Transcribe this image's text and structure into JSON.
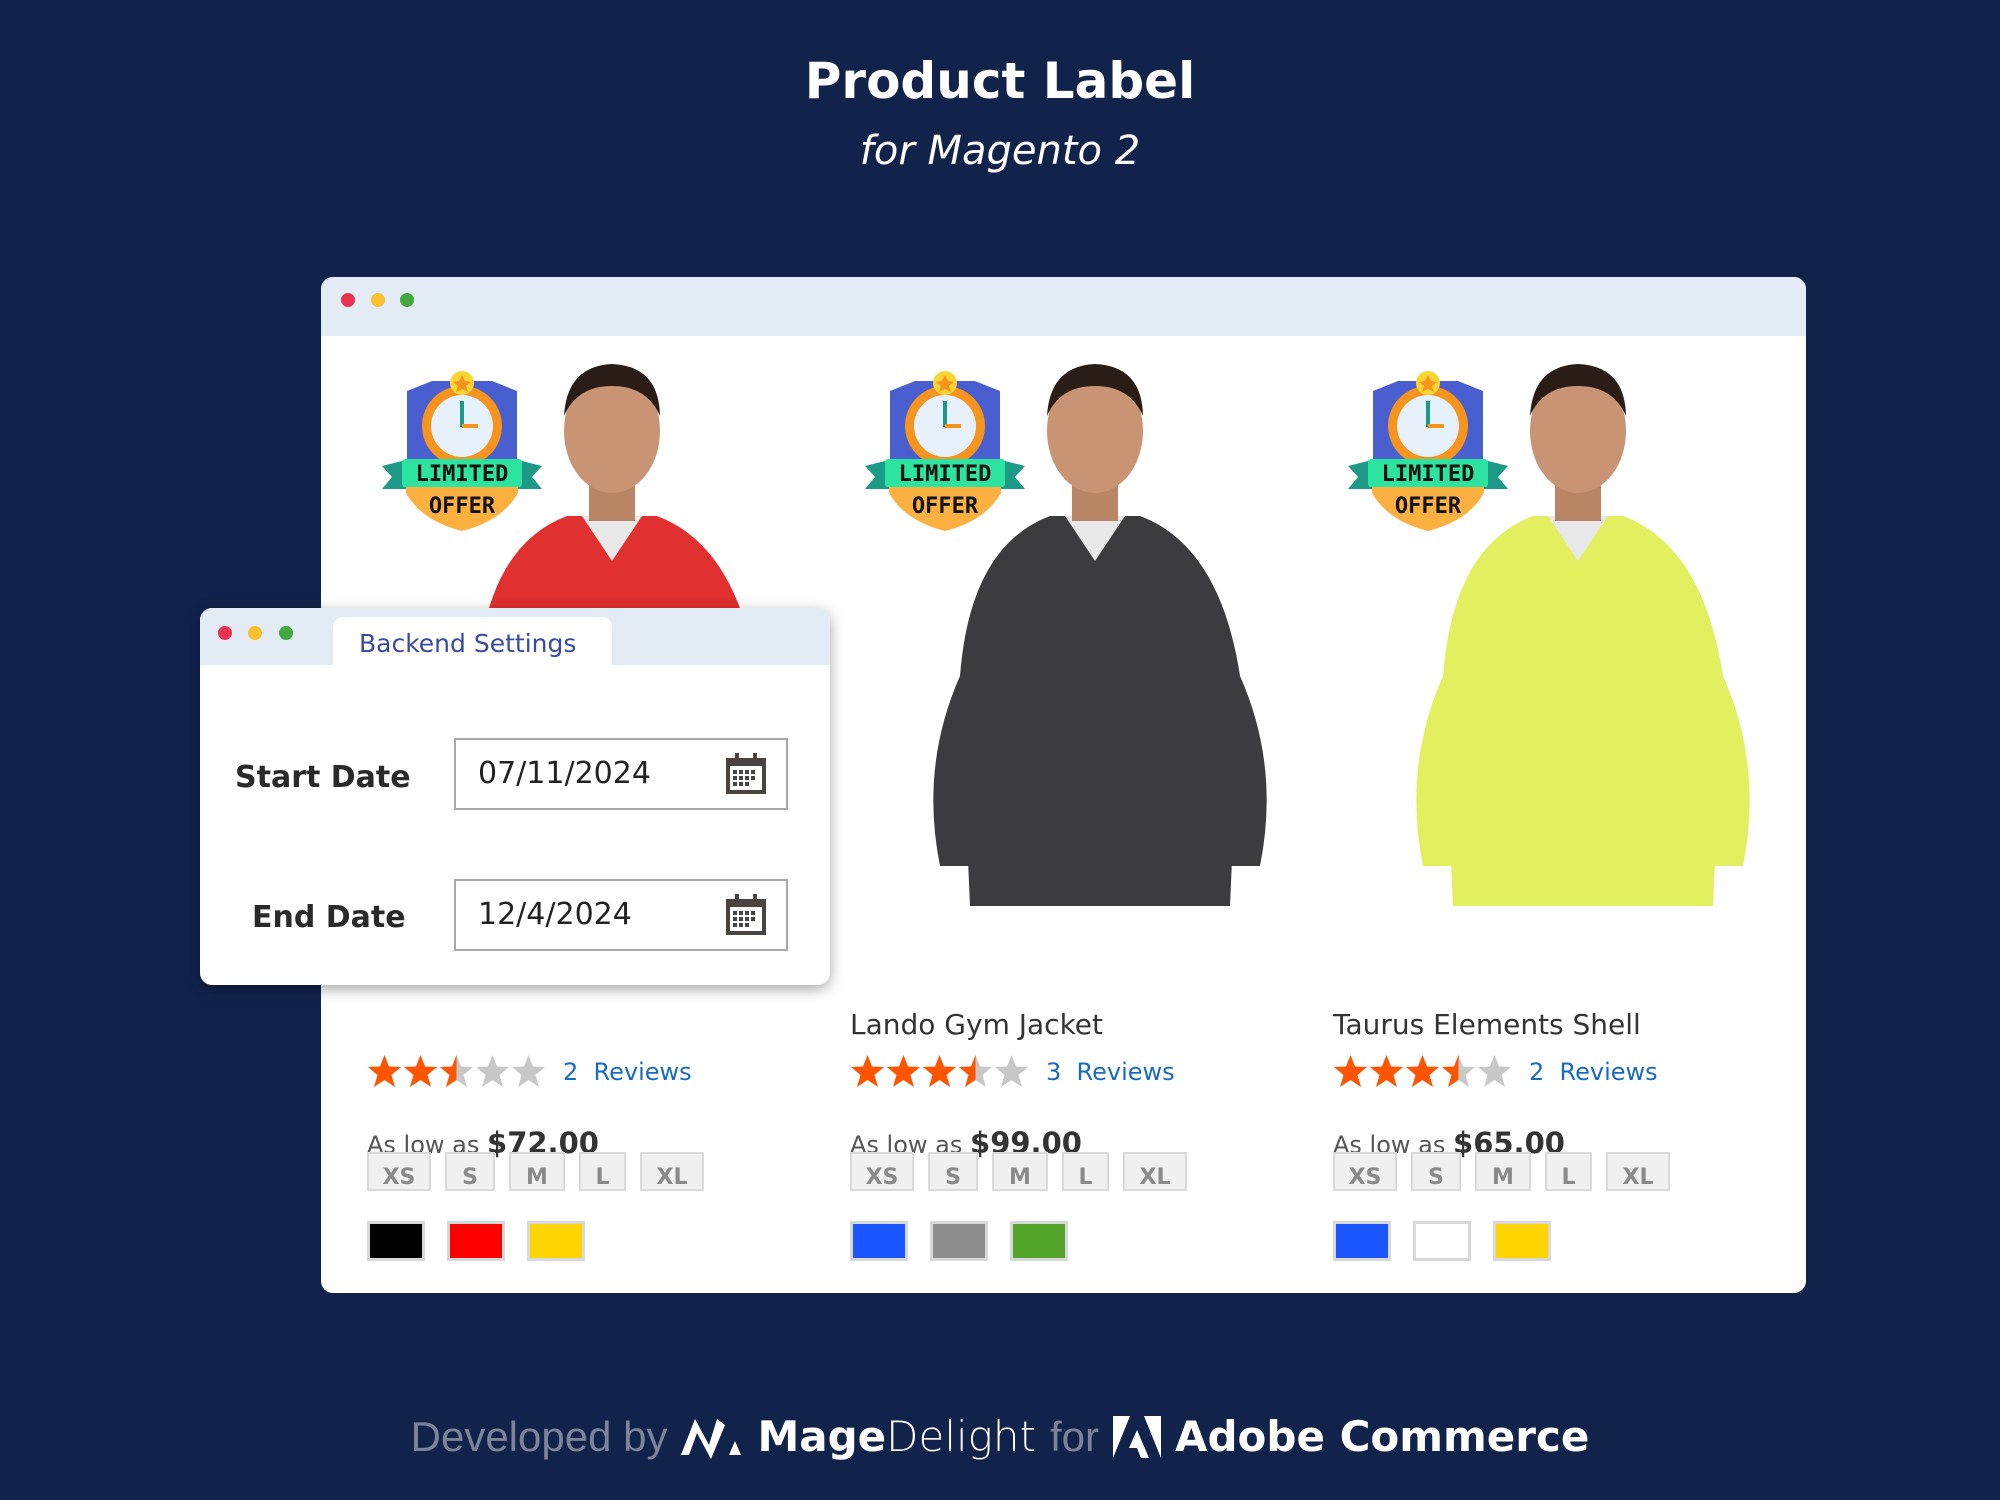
{
  "header": {
    "title": "Product Label",
    "subtitle": "for Magento 2"
  },
  "colors": {
    "background": "#11224b",
    "star": "#ff5501",
    "star_empty": "#c8c8c8",
    "link": "#1a6bbf",
    "tab_text": "#3a4aa0"
  },
  "badge": {
    "line1": "LIMITED",
    "line2": "OFFER",
    "icon": "limited-offer-clock-badge"
  },
  "products": [
    {
      "name": "",
      "rating": 2.5,
      "reviews_count": "2",
      "reviews_label": "Reviews",
      "price_prefix": "As low as",
      "price": "$72.00",
      "sizes": [
        "XS",
        "S",
        "M",
        "L",
        "XL"
      ],
      "swatches": [
        "#000000",
        "#ff0000",
        "#ffd500"
      ],
      "jacket_color": "#e03030"
    },
    {
      "name": "Lando Gym Jacket",
      "rating": 3.5,
      "reviews_count": "3",
      "reviews_label": "Reviews",
      "price_prefix": "As low as",
      "price": "$99.00",
      "sizes": [
        "XS",
        "S",
        "M",
        "L",
        "XL"
      ],
      "swatches": [
        "#1a55ff",
        "#8e8e8e",
        "#52a52a"
      ],
      "jacket_color": "#3c3c3e"
    },
    {
      "name": "Taurus Elements Shell",
      "rating": 3.5,
      "reviews_count": "2",
      "reviews_label": "Reviews",
      "price_prefix": "As low as",
      "price": "$65.00",
      "sizes": [
        "XS",
        "S",
        "M",
        "L",
        "XL"
      ],
      "swatches": [
        "#1a55ff",
        "#ffffff",
        "#ffd500"
      ],
      "jacket_color": "#e2ef5e"
    }
  ],
  "panel": {
    "tab": "Backend Settings",
    "start_label": "Start Date",
    "start_value": "07/11/2024",
    "end_label": "End Date",
    "end_value": "12/4/2024",
    "icon": "calendar-icon"
  },
  "footer": {
    "developed_by": "Developed by",
    "brand_bold": "Mage",
    "brand_light": "Delight",
    "for": "for",
    "platform": "Adobe Commerce"
  }
}
